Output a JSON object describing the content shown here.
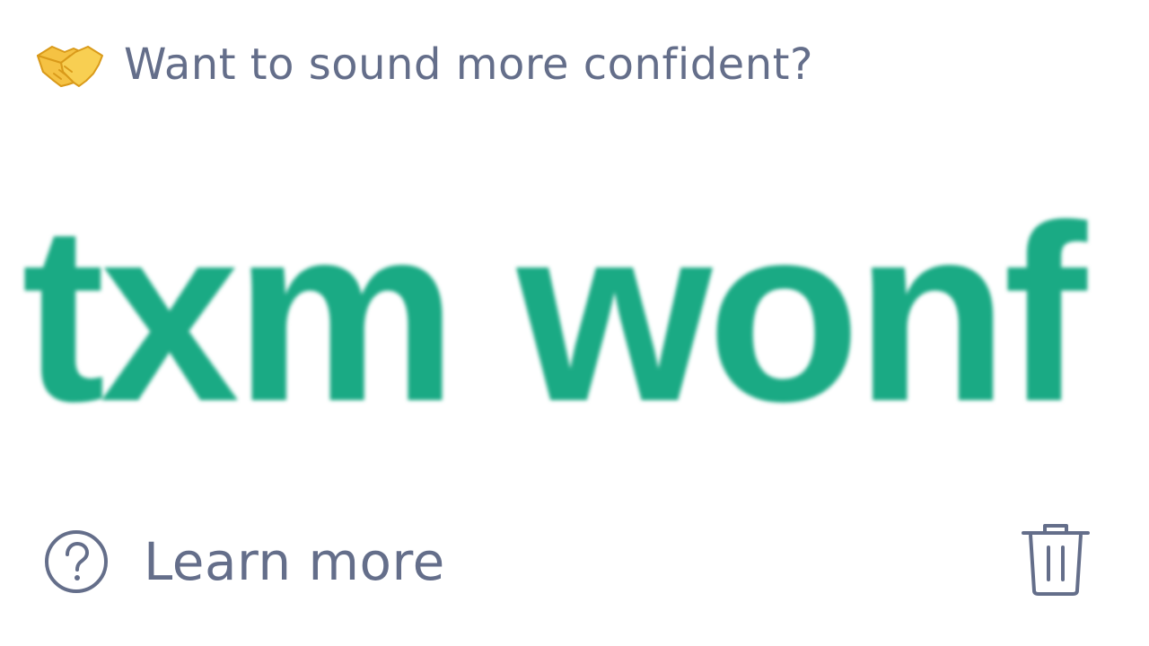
{
  "header": {
    "icon": "handshake-icon",
    "title": "Want to sound more confident?"
  },
  "suggestion": {
    "text": "txm wonf"
  },
  "footer": {
    "help_icon": "question-circle-icon",
    "learn_more_label": "Learn more",
    "delete_icon": "trash-icon"
  },
  "colors": {
    "title_text": "#646e8a",
    "suggestion_text": "#1aaa84",
    "handshake": "#f5c243"
  }
}
